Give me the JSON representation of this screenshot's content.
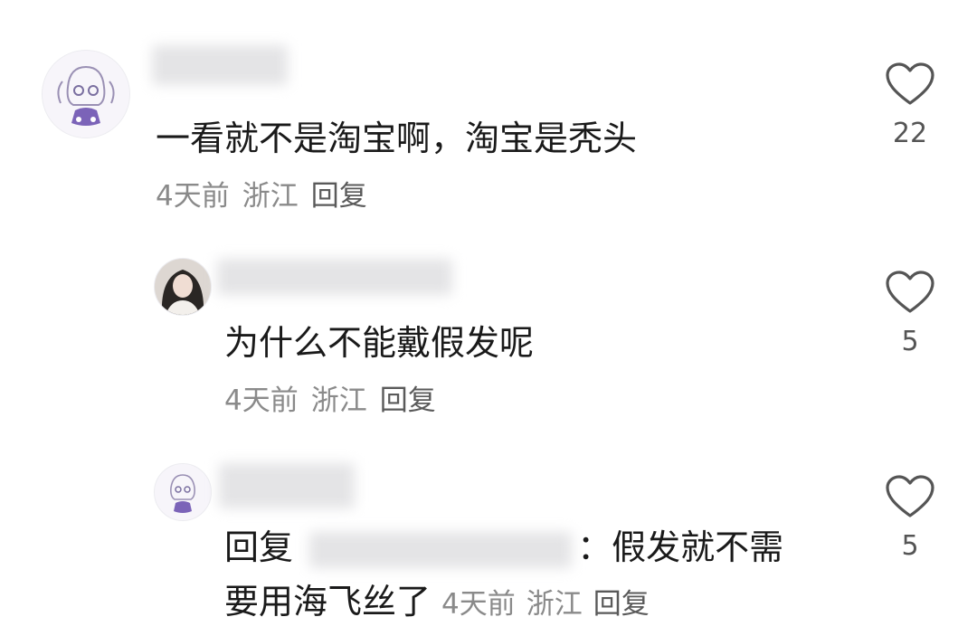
{
  "comments": [
    {
      "text": "一看就不是淘宝啊，淘宝是秃头",
      "time": "4天前",
      "location": "浙江",
      "reply_label": "回复",
      "likes": "22"
    },
    {
      "text": "为什么不能戴假发呢",
      "time": "4天前",
      "location": "浙江",
      "reply_label": "回复",
      "likes": "5"
    },
    {
      "prefix": "回复",
      "colon": "：",
      "text_line1": "假发就不需",
      "text_line2": "要用海飞丝了",
      "time": "4天前",
      "location": "浙江",
      "reply_label": "回复",
      "likes": "5"
    }
  ],
  "colors": {
    "text": "#1a1a1a",
    "meta": "#8a8a8a",
    "heart_stroke": "#555555"
  }
}
